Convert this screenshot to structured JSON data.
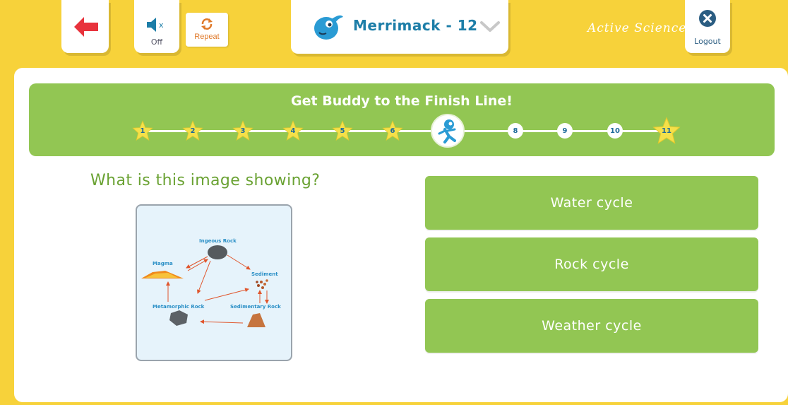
{
  "toolbar": {
    "sound_label": "Off",
    "repeat_label": "Repeat",
    "class_name": "Merrimack - 12",
    "brand": "Active Science",
    "logout_label": "Logout"
  },
  "progress": {
    "title": "Get Buddy to the Finish Line!",
    "current_step": 7,
    "steps": [
      {
        "label": "1",
        "completed": true
      },
      {
        "label": "2",
        "completed": true
      },
      {
        "label": "3",
        "completed": true
      },
      {
        "label": "4",
        "completed": true
      },
      {
        "label": "5",
        "completed": true
      },
      {
        "label": "6",
        "completed": true
      },
      {
        "label": "8",
        "completed": false
      },
      {
        "label": "9",
        "completed": false
      },
      {
        "label": "10",
        "completed": false
      },
      {
        "label": "11",
        "completed": false,
        "finish": true
      }
    ]
  },
  "question": {
    "text": "What is this image showing?",
    "image_labels": {
      "igneous": "Ingeous Rock",
      "magma": "Magma",
      "sediment": "Sediment",
      "metamorphic": "Metamorphic Rock",
      "sedimentary": "Sedimentary Rock"
    }
  },
  "answers": [
    {
      "label": "Water cycle"
    },
    {
      "label": "Rock cycle"
    },
    {
      "label": "Weather cycle"
    }
  ],
  "colors": {
    "background": "#f7d23a",
    "green": "#92c653",
    "star": "#f4e04a",
    "back_arrow": "#e8323c",
    "text_blue": "#1d7ea8"
  }
}
